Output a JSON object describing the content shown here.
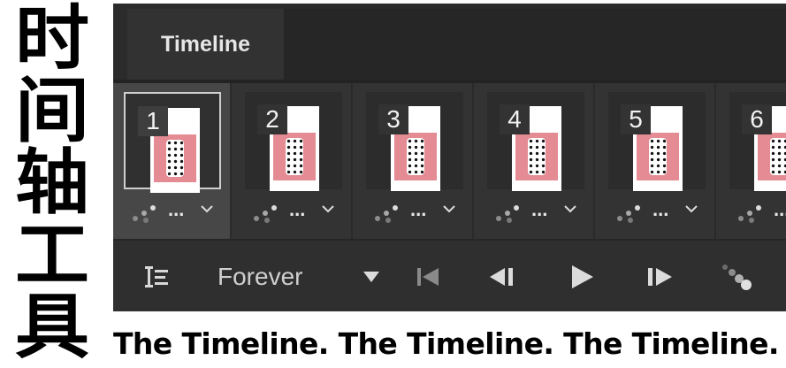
{
  "side_title": [
    "时",
    "间",
    "轴",
    "工",
    "具"
  ],
  "panel": {
    "tab_label": "Timeline",
    "frames": [
      {
        "number": "1",
        "selected": true
      },
      {
        "number": "2",
        "selected": false
      },
      {
        "number": "3",
        "selected": false
      },
      {
        "number": "4",
        "selected": false
      },
      {
        "number": "5",
        "selected": false
      },
      {
        "number": "6",
        "selected": false
      }
    ],
    "frame_delay_label": "...",
    "loop_option": "Forever"
  },
  "caption": "The Timeline. The Timeline. The Timeline.",
  "colors": {
    "panel_bg": "#232323",
    "frame_bg": "#333333",
    "selected_frame_bg": "#474747",
    "thumb_card_pink": "#e48b93"
  },
  "icons": {
    "panel_menu": "timeline-options-icon",
    "loop_dropdown": "caret-down-icon",
    "first_frame": "first-frame-icon",
    "prev_frame": "previous-frame-icon",
    "play": "play-icon",
    "next_frame": "next-frame-icon",
    "tween": "tween-icon"
  }
}
